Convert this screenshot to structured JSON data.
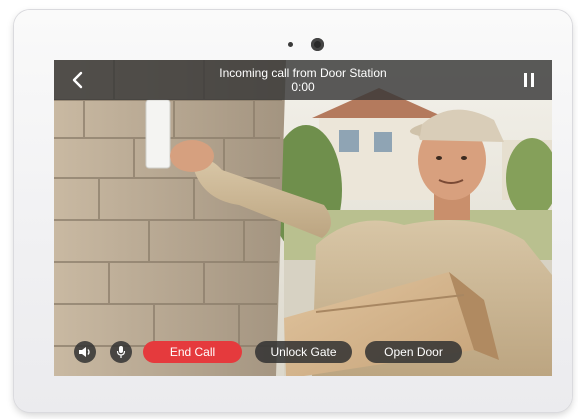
{
  "call": {
    "title": "Incoming call from Door Station",
    "timer": "0:00"
  },
  "actions": {
    "end_call": "End Call",
    "unlock_gate": "Unlock Gate",
    "open_door": "Open Door"
  },
  "icons": {
    "back": "chevron-left-icon",
    "pause": "pause-icon",
    "volume": "speaker-icon",
    "mic": "microphone-icon"
  },
  "colors": {
    "end_call": "#e53a3d",
    "bar": "#373737"
  }
}
